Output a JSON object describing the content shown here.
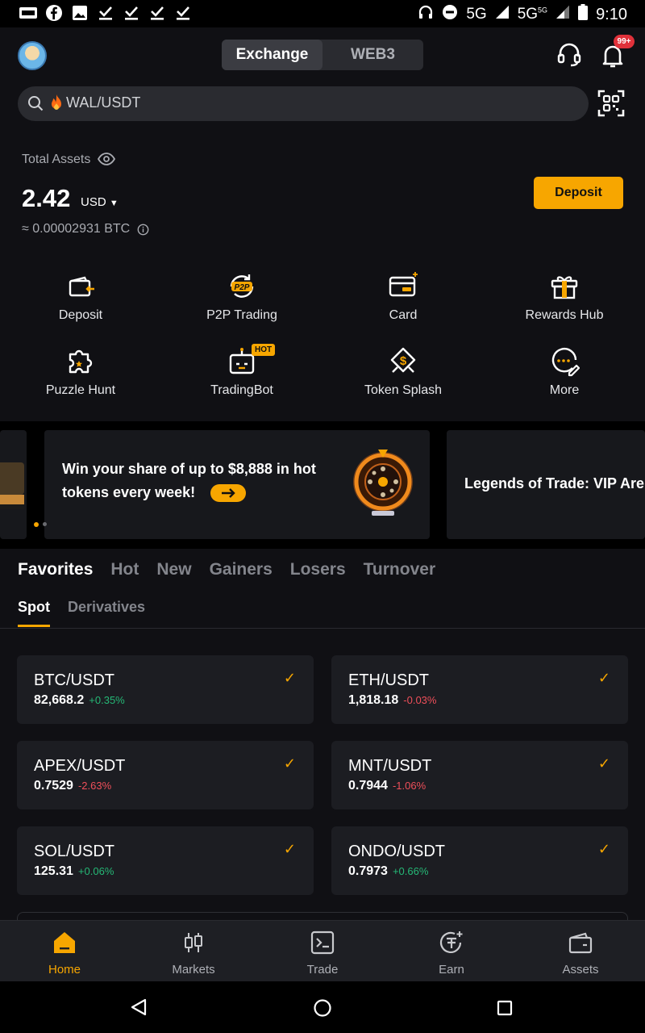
{
  "status_bar": {
    "left_icons": [
      "app-notification-icon",
      "facebook-icon",
      "image-icon",
      "check-download-icon",
      "check-download-icon",
      "check-download-icon",
      "check-download-icon"
    ],
    "network_1": "5G",
    "network_2": "5G",
    "network_2_sup": "5G",
    "time": "9:10"
  },
  "header": {
    "tabs": [
      {
        "label": "Exchange",
        "active": true
      },
      {
        "label": "WEB3",
        "active": false
      }
    ],
    "notification_badge": "99+"
  },
  "search": {
    "value": "WAL/USDT"
  },
  "assets": {
    "label": "Total Assets",
    "value": "2.42",
    "currency": "USD",
    "btc_equivalent": "≈ 0.00002931 BTC",
    "deposit_button": "Deposit"
  },
  "quick_actions": [
    {
      "label": "Deposit",
      "icon": "deposit-icon"
    },
    {
      "label": "P2P Trading",
      "icon": "p2p-icon"
    },
    {
      "label": "Card",
      "icon": "card-icon"
    },
    {
      "label": "Rewards Hub",
      "icon": "gift-icon"
    },
    {
      "label": "Puzzle Hunt",
      "icon": "puzzle-icon"
    },
    {
      "label": "TradingBot",
      "icon": "robot-icon",
      "tag": "HOT"
    },
    {
      "label": "Token Splash",
      "icon": "token-splash-icon"
    },
    {
      "label": "More",
      "icon": "more-icon"
    }
  ],
  "banners": {
    "main_text": "Win your share of up to $8,888 in hot tokens every week!",
    "next_text": "Legends of Trade: VIP Are"
  },
  "market_tabs": [
    "Favorites",
    "Hot",
    "New",
    "Gainers",
    "Losers",
    "Turnover"
  ],
  "sub_tabs": [
    "Spot",
    "Derivatives"
  ],
  "favorites": [
    {
      "pair": "BTC/USDT",
      "price": "82,668.2",
      "change": "+0.35%",
      "direction": "up"
    },
    {
      "pair": "ETH/USDT",
      "price": "1,818.18",
      "change": "-0.03%",
      "direction": "down"
    },
    {
      "pair": "APEX/USDT",
      "price": "0.7529",
      "change": "-2.63%",
      "direction": "down"
    },
    {
      "pair": "MNT/USDT",
      "price": "0.7944",
      "change": "-1.06%",
      "direction": "down"
    },
    {
      "pair": "SOL/USDT",
      "price": "125.31",
      "change": "+0.06%",
      "direction": "up"
    },
    {
      "pair": "ONDO/USDT",
      "price": "0.7973",
      "change": "+0.66%",
      "direction": "up"
    }
  ],
  "bottom_nav": [
    {
      "label": "Home",
      "active": true
    },
    {
      "label": "Markets",
      "active": false
    },
    {
      "label": "Trade",
      "active": false
    },
    {
      "label": "Earn",
      "active": false
    },
    {
      "label": "Assets",
      "active": false
    }
  ],
  "colors": {
    "accent": "#f7a600",
    "positive": "#25b876",
    "negative": "#ef4f5a",
    "background": "#101014"
  }
}
